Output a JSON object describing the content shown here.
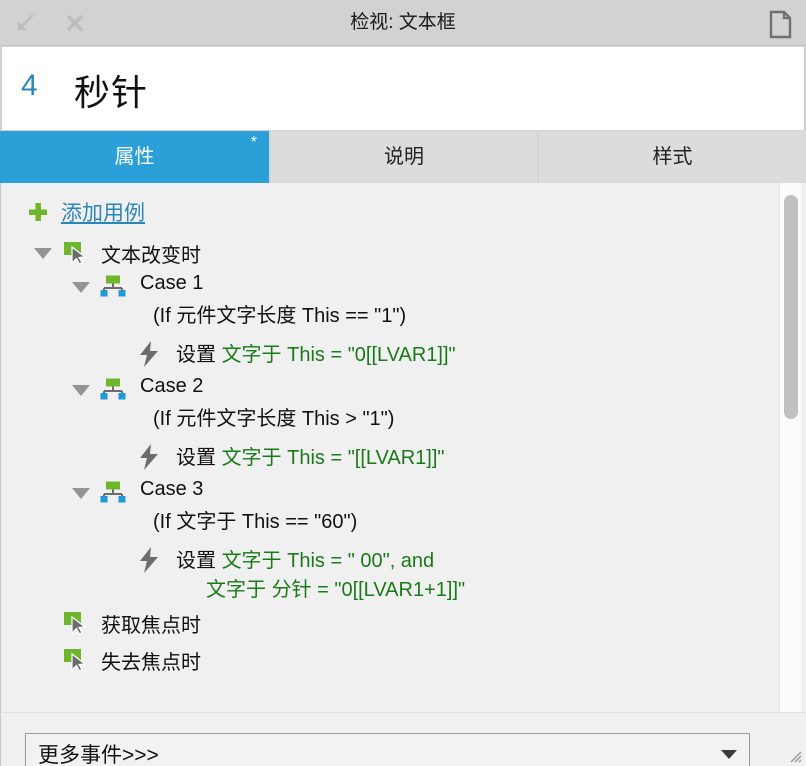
{
  "window": {
    "title": "检视: 文本框",
    "collapse_icon": "collapse-arrow-icon",
    "close_icon": "close-icon",
    "doc_icon": "document-icon"
  },
  "header": {
    "index": "4",
    "name": "秒针"
  },
  "tabs": [
    {
      "label": "属性",
      "active": true,
      "modified_marker": "*"
    },
    {
      "label": "说明",
      "active": false,
      "modified_marker": ""
    },
    {
      "label": "样式",
      "active": false,
      "modified_marker": ""
    }
  ],
  "toolbar": {
    "add_case_label": "添加用例",
    "plus_icon": "plus-icon"
  },
  "tree": {
    "events": [
      {
        "name": "文本改变时",
        "expanded": true,
        "icon": "event-cursor-icon",
        "cases": [
          {
            "name": "Case 1",
            "condition": "(If 元件文字长度 This == \"1\")",
            "expanded": true,
            "icon": "case-hierarchy-icon",
            "actions": [
              {
                "icon": "lightning-icon",
                "verb": "设置",
                "lines": [
                  {
                    "text": "文字于 This = \"0[[LVAR1]]\"",
                    "color": "green"
                  }
                ]
              }
            ]
          },
          {
            "name": "Case 2",
            "condition": "(If 元件文字长度 This > \"1\")",
            "expanded": true,
            "icon": "case-hierarchy-icon",
            "actions": [
              {
                "icon": "lightning-icon",
                "verb": "设置",
                "lines": [
                  {
                    "text": "文字于 This = \"[[LVAR1]]\"",
                    "color": "green"
                  }
                ]
              }
            ]
          },
          {
            "name": "Case 3",
            "condition": "(If 文字于 This == \"60\")",
            "expanded": true,
            "icon": "case-hierarchy-icon",
            "actions": [
              {
                "icon": "lightning-icon",
                "verb": "设置",
                "lines": [
                  {
                    "text": "文字于 This = \" 00\", and",
                    "color": "green"
                  },
                  {
                    "text": "文字于 分针 = \"0[[LVAR1+1]]\"",
                    "color": "green"
                  }
                ]
              }
            ]
          }
        ]
      },
      {
        "name": "获取焦点时",
        "expanded": false,
        "icon": "event-cursor-icon",
        "cases": []
      },
      {
        "name": "失去焦点时",
        "expanded": false,
        "icon": "event-cursor-icon",
        "cases": []
      }
    ]
  },
  "footer": {
    "more_events_label": "更多事件>>>",
    "dropdown_icon": "chevron-down-icon",
    "resize_grip_icon": "resize-grip-icon"
  },
  "scrollbar": {
    "orientation": "vertical",
    "thumb_icon": "scroll-thumb"
  },
  "colors": {
    "accent_blue": "#2b9fd8",
    "link_blue": "#2b86b8",
    "green": "#1a7a1a",
    "icon_green": "#6fb62c",
    "icon_blue": "#1f9ad6",
    "panel_bg": "#f0f0f0",
    "titlebar_bg": "#d2d2d2"
  }
}
